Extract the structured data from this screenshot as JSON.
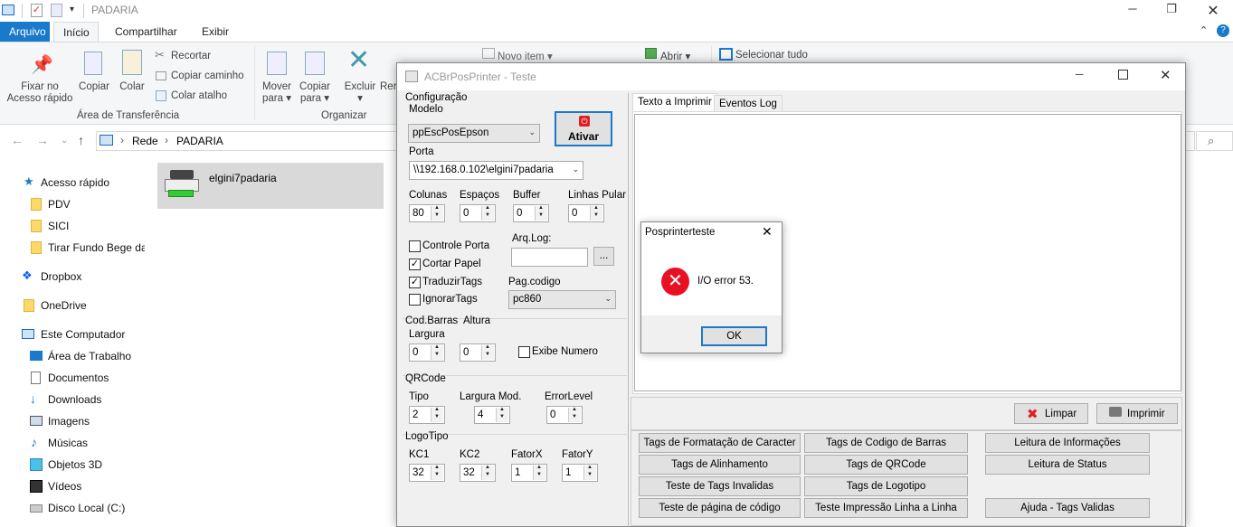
{
  "explorer": {
    "title": "PADARIA",
    "tabs": [
      "Arquivo",
      "Início",
      "Compartilhar",
      "Exibir"
    ],
    "ribbon": {
      "pin": "Fixar no\nAcesso rápido",
      "copy": "Copiar",
      "paste": "Colar",
      "cut": "Recortar",
      "copy_path": "Copiar caminho",
      "paste_shortcut": "Colar atalho",
      "clipboard_group": "Área de Transferência",
      "move_to": "Mover\npara ▾",
      "copy_to": "Copiar\npara ▾",
      "delete": "Excluir\n▾",
      "rename": "Rer",
      "organize_group": "Organizar",
      "new_item": "Novo item ▾",
      "open": "Abrir ▾",
      "select_all": "Selecionar tudo"
    },
    "breadcrumb": [
      "Rede",
      "PADARIA"
    ],
    "sidebar": [
      {
        "label": "Acesso rápido",
        "icon": "star-icon"
      },
      {
        "label": "PDV",
        "icon": "folder-icon"
      },
      {
        "label": "SICI",
        "icon": "folder-icon"
      },
      {
        "label": "Tirar Fundo Bege da",
        "icon": "folder-icon"
      },
      {
        "label": "Dropbox",
        "icon": "dropbox-icon"
      },
      {
        "label": "OneDrive",
        "icon": "folder-icon"
      },
      {
        "label": "Este Computador",
        "icon": "computer-icon"
      },
      {
        "label": "Área de Trabalho",
        "icon": "desktop-icon"
      },
      {
        "label": "Documentos",
        "icon": "document-icon"
      },
      {
        "label": "Downloads",
        "icon": "download-icon"
      },
      {
        "label": "Imagens",
        "icon": "image-icon"
      },
      {
        "label": "Músicas",
        "icon": "music-icon"
      },
      {
        "label": "Objetos 3D",
        "icon": "cube-icon"
      },
      {
        "label": "Vídeos",
        "icon": "video-icon"
      },
      {
        "label": "Disco Local (C:)",
        "icon": "drive-icon"
      }
    ],
    "printer_item": "elgini7padaria"
  },
  "acbr": {
    "title": "ACBrPosPrinter - Teste",
    "config_label": "Configuração",
    "modelo_label": "Modelo",
    "modelo_value": "ppEscPosEpson",
    "ativar": "Ativar",
    "porta_label": "Porta",
    "porta_value": "\\\\192.168.0.102\\elgini7padaria",
    "colunas_label": "Colunas",
    "colunas_value": "80",
    "espacos_label": "Espaços",
    "espacos_value": "0",
    "buffer_label": "Buffer",
    "buffer_value": "0",
    "linhas_label": "Linhas Pular",
    "linhas_value": "0",
    "controle_porta": "Controle Porta",
    "cortar_papel": "Cortar Papel",
    "traduzir_tags": "TraduzirTags",
    "ignorar_tags": "IgnorarTags",
    "arq_log_label": "Arq.Log:",
    "browse": "...",
    "pag_codigo_label": "Pag.codigo",
    "pag_codigo_value": "pc860",
    "cod_barras_label": "Cod.Barras",
    "altura_label": "Altura",
    "largura_label": "Largura",
    "largura_value": "0",
    "altura_value": "0",
    "exibe_numero": "Exibe Numero",
    "qrcode_label": "QRCode",
    "tipo_label": "Tipo",
    "tipo_value": "2",
    "largura_mod_label": "Largura Mod.",
    "largura_mod_value": "4",
    "error_level_label": "ErrorLevel",
    "error_level_value": "0",
    "logotipo_label": "LogoTipo",
    "kc1_label": "KC1",
    "kc1_value": "32",
    "kc2_label": "KC2",
    "kc2_value": "32",
    "fatorx_label": "FatorX",
    "fatorx_value": "1",
    "fatory_label": "FatorY",
    "fatory_value": "1",
    "tab_texto": "Texto a Imprimir",
    "tab_eventos": "Eventos Log",
    "limpar": "Limpar",
    "imprimir": "Imprimir",
    "buttons": {
      "formatacao": "Tags de Formatação de Caracter",
      "alinhamento": "Tags de Alinhamento",
      "invalidas": "Teste de Tags Invalidas",
      "pagina_codigo": "Teste de página de código",
      "codigo_barras": "Tags de Codigo de Barras",
      "qrcode": "Tags de QRCode",
      "logotipo": "Tags de Logotipo",
      "linha_a_linha": "Teste Impressão Linha a Linha",
      "leitura_info": "Leitura de Informações",
      "leitura_status": "Leitura de Status",
      "ajuda": "Ajuda - Tags Validas"
    }
  },
  "msgbox": {
    "title": "Posprinterteste",
    "message": "I/O error 53.",
    "ok": "OK"
  },
  "colors": {
    "accent": "#1979ca",
    "error": "#e81123"
  }
}
